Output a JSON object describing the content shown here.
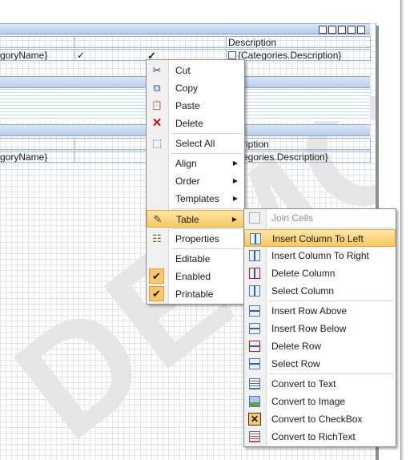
{
  "report": {
    "header_row": {
      "c1": "",
      "c2": "",
      "c3": "Description"
    },
    "data_row1": {
      "c1": "goryName}",
      "check1": "✓",
      "check2": "✓",
      "c3": "{Categories.Description}"
    },
    "header_row2": {
      "c3": "ription"
    },
    "data_row2": {
      "c1": "goryName}",
      "c3": "egories.Description}"
    },
    "watermark": "DEMO"
  },
  "context_menu": {
    "items": [
      {
        "label": "Cut",
        "icon": "scissors-icon",
        "glyph": "✂"
      },
      {
        "label": "Copy",
        "icon": "copy-icon",
        "glyph": "⧉"
      },
      {
        "label": "Paste",
        "icon": "paste-icon",
        "glyph": "📋"
      },
      {
        "label": "Delete",
        "icon": "delete-icon",
        "glyph": "✕"
      },
      {
        "label": "Select All",
        "icon": "select-all-icon",
        "glyph": "⬚"
      },
      {
        "label": "Align",
        "submenu": true
      },
      {
        "label": "Order",
        "submenu": true
      },
      {
        "label": "Templates",
        "submenu": true
      },
      {
        "label": "Table",
        "submenu": true,
        "icon": "table-edit-icon",
        "glyph": "✎"
      },
      {
        "label": "Properties",
        "icon": "properties-icon",
        "glyph": "☷"
      },
      {
        "label": "Editable"
      },
      {
        "label": "Enabled",
        "checked": true
      },
      {
        "label": "Printable",
        "checked": true
      }
    ],
    "arrow": "▶",
    "check_glyph": "✔"
  },
  "table_submenu": {
    "items": [
      {
        "label": "Join Cells",
        "disabled": true
      },
      {
        "label": "Insert Column To Left",
        "highlighted": true
      },
      {
        "label": "Insert Column To Right"
      },
      {
        "label": "Delete Column"
      },
      {
        "label": "Select Column"
      },
      {
        "label": "Insert Row Above"
      },
      {
        "label": "Insert Row Below"
      },
      {
        "label": "Delete Row"
      },
      {
        "label": "Select Row"
      },
      {
        "label": "Convert to Text"
      },
      {
        "label": "Convert to Image"
      },
      {
        "label": "Convert to CheckBox"
      },
      {
        "label": "Convert to RichText"
      }
    ]
  },
  "colors": {
    "highlight": "#f9c85f",
    "band": "#b9cdea",
    "grid": "#dfe7f0",
    "delete_red": "#cc1111"
  }
}
